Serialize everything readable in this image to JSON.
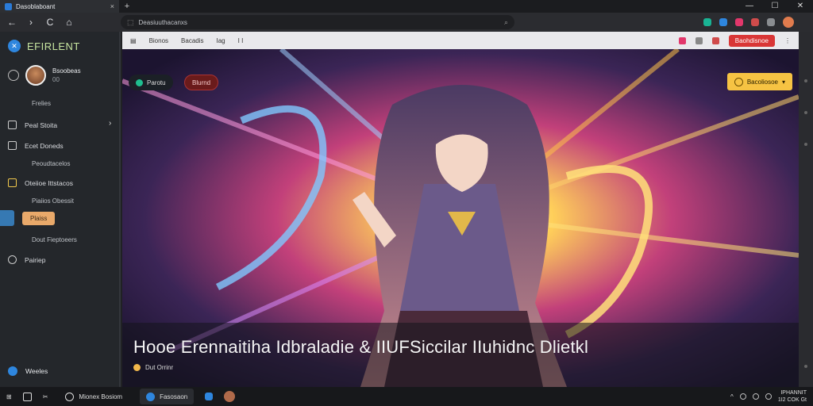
{
  "window": {
    "tab_title": "Dasoblaboant",
    "tab_close": "×",
    "new_tab": "+",
    "min": "—",
    "max": "☐",
    "close": "✕"
  },
  "addressbar": {
    "back": "←",
    "forward": "›",
    "reload": "C",
    "home": "⌂",
    "url": "Deasiuuthacanxs"
  },
  "sidebar": {
    "brand": "EFIRLENT",
    "profile_name": "Bsoobeas",
    "profile_sub": "00",
    "section_1": "Frelies",
    "items": [
      {
        "label": "Peal Stoita"
      },
      {
        "label": "Ecet Doneds"
      },
      {
        "label": "Peoudtacelos"
      },
      {
        "label": "Oteiioe Ittstacos"
      },
      {
        "label": "Piaiios Obessit"
      }
    ],
    "active_label": "Plaiss",
    "item_after": "Dout Fieptoeers",
    "item_pairing": "Pairiep",
    "bottom_label": "Weeles"
  },
  "content": {
    "toolbar": [
      "Bionos",
      "Bacadis",
      "Iag",
      "I I"
    ],
    "toolbar_btn": "Baohdisnoe",
    "chip_dark": "Parotu",
    "chip_red": "Blurnd",
    "cta": "Bacoliosoe",
    "caption_title": "Hooe Erennaitiha Idbraladie & IIUFSiccilar IIuhidnc Dlietkl",
    "caption_meta": "Dut Orrinr"
  },
  "taskbar": {
    "app1": "Mionex Bosiom",
    "app2": "Fasosaon",
    "clock_time": "IPHANNIT",
    "clock_date": "1I2 COK Gt"
  }
}
